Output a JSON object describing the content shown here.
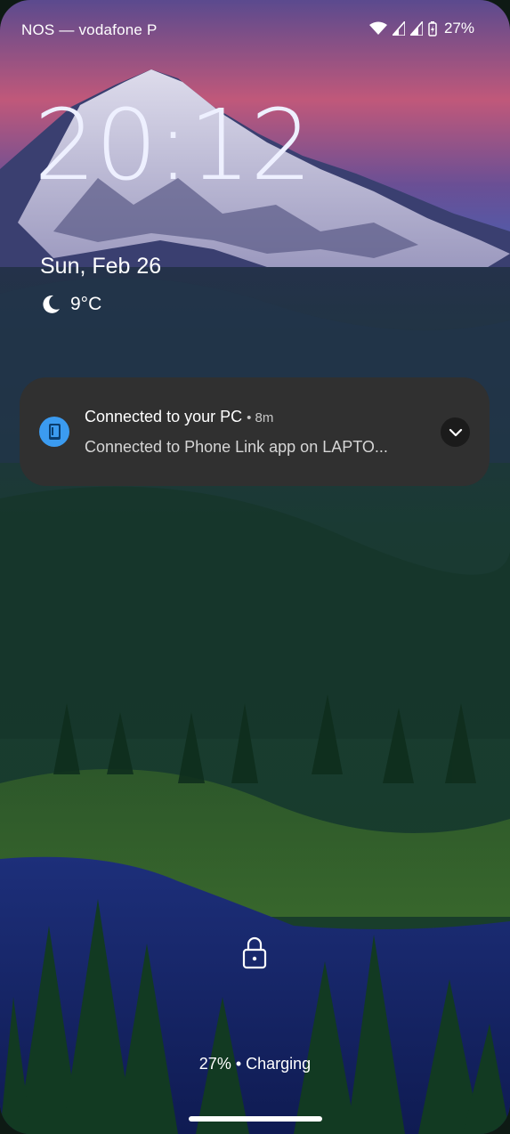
{
  "status_bar": {
    "carrier": "NOS — vodafone P",
    "battery_percent": "27%",
    "icons": [
      "wifi-icon",
      "signal-icon",
      "signal-icon",
      "battery-charging-icon"
    ]
  },
  "lockscreen": {
    "time": "20:12",
    "date": "Sun, Feb 26",
    "weather": {
      "icon": "moon-icon",
      "temperature": "9°C"
    },
    "charging_status": "27% • Charging"
  },
  "notification": {
    "app_icon": "phone-link-icon",
    "title": "Connected to your PC",
    "time": "• 8m",
    "body": "Connected to Phone Link app on LAPTO...",
    "expand_icon": "chevron-down-icon"
  },
  "colors": {
    "notification_bg": "#303030",
    "app_icon_accent": "#3b9bf0",
    "clock": "#eef0ff"
  }
}
